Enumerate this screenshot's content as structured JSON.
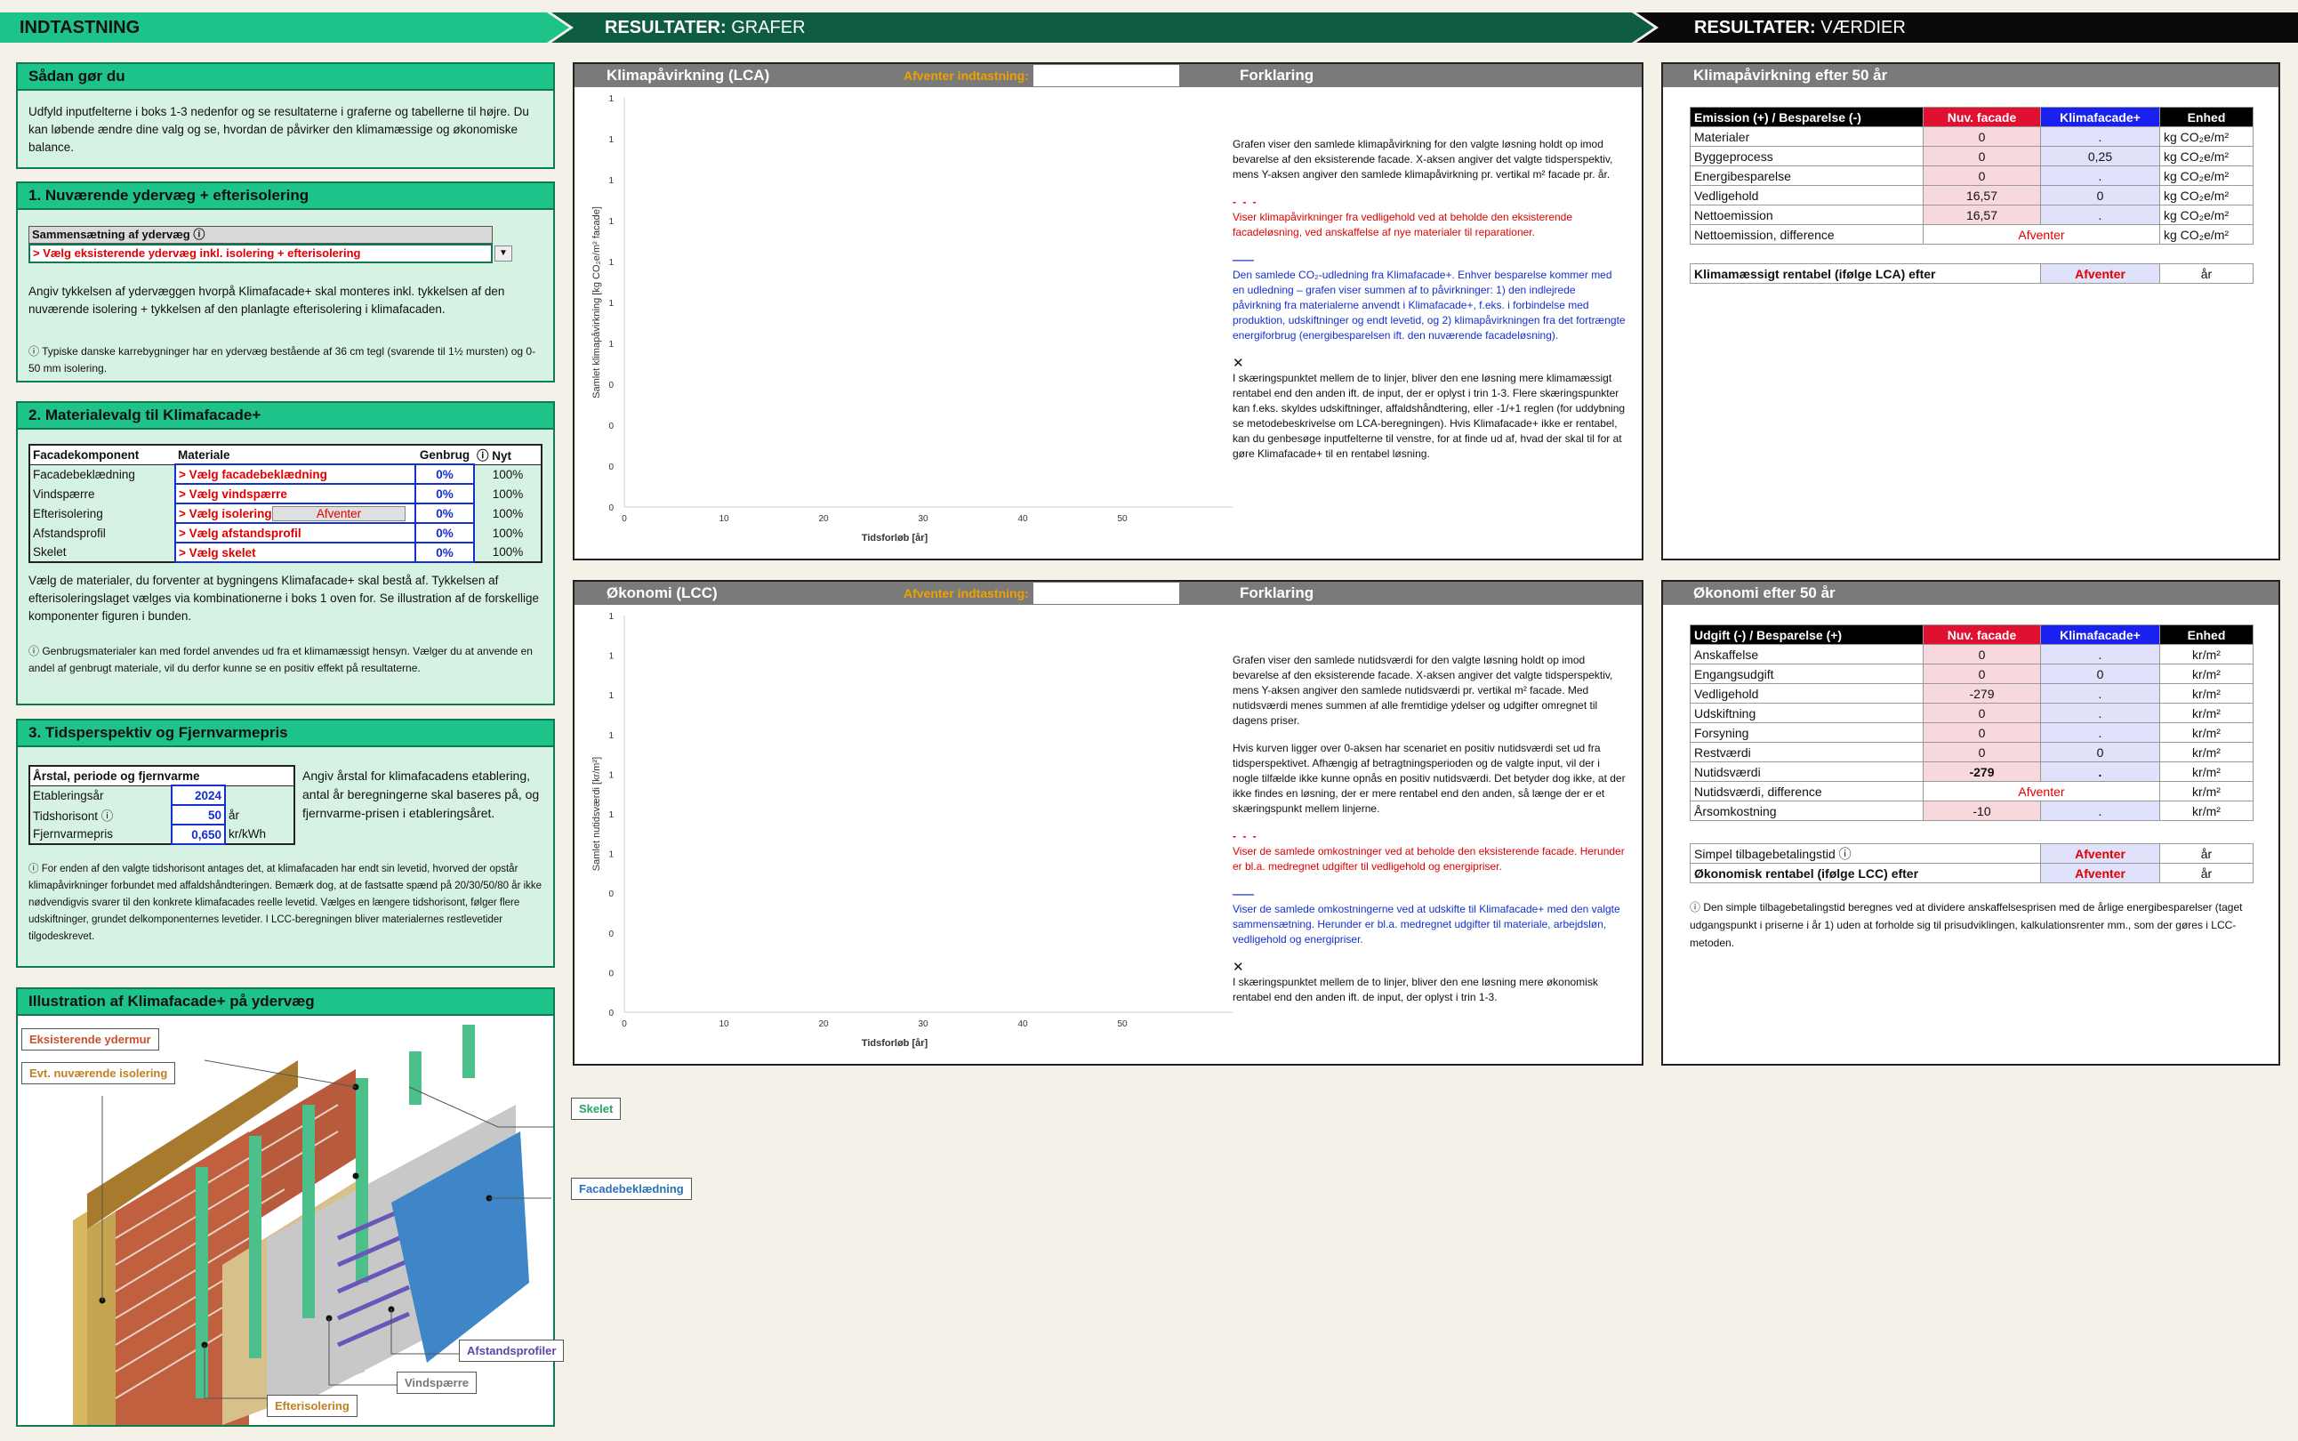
{
  "banners": {
    "input": "INDTASTNING",
    "graphs_bold": "RESULTATER:",
    "graphs_light": "GRAFER",
    "values_bold": "RESULTATER:",
    "values_light": "VÆRDIER"
  },
  "howto": {
    "title": "Sådan gør du",
    "text": "Udfyld inputfelterne i boks 1-3 nedenfor og se resultaterne i graferne og tabellerne til højre. Du kan løbende ændre dine valg og se, hvordan de påvirker den klimamæssige og økonomiske balance."
  },
  "section1": {
    "title": "1.  Nuværende ydervæg + efterisolering",
    "label": "Sammensætning af ydervæg ⓘ",
    "select_value": "> Vælg eksisterende ydervæg inkl. isolering + efterisolering",
    "text": "Angiv tykkelsen af ydervæggen hvorpå Klimafacade+ skal monteres inkl. tykkelsen af den nuværende isolering + tykkelsen af den planlagte efterisolering i klimafacaden.",
    "note": "ⓘ Typiske danske karrebygninger har en ydervæg bestående af 36 cm tegl (svarende til 1½ mursten) og 0-50 mm isolering."
  },
  "section2": {
    "title": "2. Materialevalg til Klimafacade+",
    "headers": [
      "Facadekomponent",
      "Materiale",
      "Genbrug",
      "ⓘ Nyt"
    ],
    "rows": [
      {
        "component": "Facadebeklædning",
        "material": "> Vælg facadebeklædning",
        "reuse": "0%",
        "new": "100%"
      },
      {
        "component": "Vindspærre",
        "material": "> Vælg vindspærre",
        "reuse": "0%",
        "new": "100%"
      },
      {
        "component": "Efterisolering",
        "material": "> Vælg isolering",
        "extra": "Afventer",
        "reuse": "0%",
        "new": "100%"
      },
      {
        "component": "Afstandsprofil",
        "material": "> Vælg afstandsprofil",
        "reuse": "0%",
        "new": "100%"
      },
      {
        "component": "Skelet",
        "material": "> Vælg skelet",
        "reuse": "0%",
        "new": "100%"
      }
    ],
    "text": "Vælg de materialer, du forventer at bygningens Klimafacade+ skal bestå af. Tykkelsen af efterisoleringslaget vælges via kombinationerne i boks 1 oven for. Se illustration af de forskellige komponenter figuren i bunden.",
    "note": "ⓘ Genbrugsmaterialer kan med fordel anvendes ud fra et klimamæssigt hensyn. Vælger du at anvende en andel af genbrugt materiale, vil du derfor kunne se en positiv effekt på resultaterne."
  },
  "section3": {
    "title": "3. Tidsperspektiv og Fjernvarmepris",
    "table_header": "Årstal, periode og fjernvarme",
    "rows": [
      {
        "label": "Etableringsår",
        "value": "2024",
        "unit": ""
      },
      {
        "label": "Tidshorisont ⓘ",
        "value": "50",
        "unit": "år"
      },
      {
        "label": "Fjernvarmepris",
        "value": "0,650",
        "unit": "kr/kWh"
      }
    ],
    "side_text": "Angiv årstal for klimafacadens etablering, antal år beregningerne skal baseres på, og fjernvarme-prisen i etableringsåret.",
    "note": "ⓘ For enden af den valgte tidshorisont antages det, at klimafacaden har endt sin levetid, hvorved der opstår klimapåvirkninger forbundet med affaldshåndteringen. Bemærk dog, at de fastsatte spænd på 20/30/50/80 år ikke nødvendigvis svarer til den konkrete klimafacades reelle levetid. Vælges en længere tidshorisont, følger flere udskiftninger, grundet delkomponenternes levetider. I LCC-beregningen bliver materialernes restlevetider tilgodeskrevet."
  },
  "illustration": {
    "title": "Illustration af Klimafacade+ på ydervæg",
    "labels": {
      "existing_wall": "Eksisterende ydermur",
      "existing_insulation": "Evt. nuværende isolering",
      "frame": "Skelet",
      "cladding": "Facadebeklædning",
      "spacers": "Afstandsprofiler",
      "windbarrier": "Vindspærre",
      "insulation": "Efterisolering"
    }
  },
  "lca_chart": {
    "title": "Klimapåvirkning (LCA)",
    "waiting_label": "Afventer indtastning:",
    "legend_title": "Forklaring",
    "ylabel": "Samlet klimapåvirkning   [kg CO₂e/m² facade]",
    "xlabel": "Tidsforløb   [år]",
    "y_ticks": [
      "1",
      "1",
      "1",
      "1",
      "1",
      "1",
      "1",
      "0",
      "0",
      "0",
      "0"
    ],
    "x_ticks": [
      "0",
      "10",
      "20",
      "30",
      "40",
      "50"
    ],
    "expl_1": "Grafen viser den samlede klimapåvirkning for den valgte løsning holdt op imod bevarelse af den eksisterende facade. X-aksen angiver det valgte tidsperspektiv, mens Y-aksen angiver den samlede klimapåvirkning pr. vertikal m² facade pr. år.",
    "expl_red": "Viser klimapåvirkninger fra vedligehold ved at beholde den eksisterende facadeløsning, ved anskaffelse af nye materialer til reparationer.",
    "expl_blue": "Den samlede CO₂-udledning fra Klimafacade+. Enhver besparelse kommer med en udledning – grafen viser summen af to påvirkninger: 1) den indlejrede påvirkning fra materialerne anvendt i Klimafacade+, f.eks. i forbindelse med produktion, udskiftninger og endt levetid, og 2) klimapåvirkningen fra det fortrængte energiforbrug (energibesparelsen ift. den nuværende facadeløsning).",
    "expl_cross": "I skæringspunktet mellem de to linjer, bliver den ene løsning mere klimamæssigt rentabel end den anden ift. de input, der er oplyst i trin 1-3. Flere skæringspunkter kan f.eks. skyldes udskiftninger, affaldshåndtering, eller -1/+1 reglen (for uddybning se metodebeskrivelse om LCA-beregningen). Hvis Klimafacade+ ikke er rentabel, kan du genbesøge inputfelterne til venstre, for at finde ud af, hvad der skal til for at gøre Klimafacade+ til en rentabel løsning."
  },
  "lcc_chart": {
    "title": "Økonomi (LCC)",
    "waiting_label": "Afventer indtastning:",
    "legend_title": "Forklaring",
    "ylabel": "Samlet nutidsværdi   [kr/m²]",
    "xlabel": "Tidsforløb   [år]",
    "y_ticks": [
      "1",
      "1",
      "1",
      "1",
      "1",
      "1",
      "1",
      "0",
      "0",
      "0",
      "0"
    ],
    "x_ticks": [
      "0",
      "10",
      "20",
      "30",
      "40",
      "50"
    ],
    "expl_1": "Grafen viser den samlede nutidsværdi for den valgte løsning holdt op imod bevarelse af den eksisterende facade. X-aksen angiver det valgte tidsperspektiv, mens Y-aksen angiver den samlede nutidsværdi pr. vertikal m² facade. Med nutidsværdi menes summen af alle fremtidige ydelser og udgifter omregnet til dagens priser.",
    "expl_2": "Hvis kurven ligger over 0-aksen har scenariet en positiv nutidsværdi set ud fra tidsperspektivet. Afhængig af betragtningsperioden og de valgte input, vil der i nogle tilfælde ikke kunne opnås en positiv nutidsværdi. Det betyder dog ikke, at der ikke findes en løsning, der er mere rentabel end den anden, så længe der er et skæringspunkt mellem linjerne.",
    "expl_red": "Viser de samlede omkostninger ved at beholde den eksisterende facade. Herunder er bl.a. medregnet udgifter til vedligehold og energipriser.",
    "expl_blue": "Viser de samlede omkostningerne ved at udskifte til Klimafacade+ med den valgte sammensætning. Herunder er bl.a. medregnet udgifter til materiale, arbejdsløn, vedligehold og energipriser.",
    "expl_cross": "I skæringspunktet mellem de to linjer, bliver den ene løsning mere økonomisk rentabel end den anden ift. de input, der oplyst i trin 1-3."
  },
  "lca_values": {
    "title": "Klimapåvirkning efter 50 år",
    "headers": [
      "Emission (+) / Besparelse (-)",
      "Nuv. facade",
      "Klimafacade+",
      "Enhed"
    ],
    "rows": [
      {
        "label": "Materialer",
        "a": "0",
        "b": ".",
        "unit": "kg CO₂e/m²"
      },
      {
        "label": "Byggeprocess",
        "a": "0",
        "b": "0,25",
        "unit": "kg CO₂e/m²"
      },
      {
        "label": "Energibesparelse",
        "a": "0",
        "b": ".",
        "unit": "kg CO₂e/m²"
      },
      {
        "label": "Vedligehold",
        "a": "16,57",
        "b": "0",
        "unit": "kg CO₂e/m²"
      },
      {
        "label": "Nettoemission",
        "a": "16,57",
        "b": ".",
        "unit": "kg CO₂e/m²"
      }
    ],
    "diff_label": "Nettoemission, difference",
    "diff_value": "Afventer",
    "diff_unit": "kg CO₂e/m²",
    "rent_label": "Klimamæssigt rentabel (ifølge LCA) efter",
    "rent_value": "Afventer",
    "rent_unit": "år"
  },
  "lcc_values": {
    "title": "Økonomi efter 50 år",
    "headers": [
      "Udgift (-) / Besparelse (+)",
      "Nuv. facade",
      "Klimafacade+",
      "Enhed"
    ],
    "rows": [
      {
        "label": "Anskaffelse",
        "a": "0",
        "b": ".",
        "unit": "kr/m²"
      },
      {
        "label": "Engangsudgift",
        "a": "0",
        "b": "0",
        "unit": "kr/m²"
      },
      {
        "label": "Vedligehold",
        "a": "-279",
        "b": ".",
        "unit": "kr/m²"
      },
      {
        "label": "Udskiftning",
        "a": "0",
        "b": ".",
        "unit": "kr/m²"
      },
      {
        "label": "Forsyning",
        "a": "0",
        "b": ".",
        "unit": "kr/m²"
      },
      {
        "label": "Restværdi",
        "a": "0",
        "b": "0",
        "unit": "kr/m²"
      },
      {
        "label": "Nutidsværdi",
        "a": "-279",
        "b": ".",
        "unit": "kr/m²"
      }
    ],
    "diff_label": "Nutidsværdi, difference",
    "diff_value": "Afventer",
    "diff_unit": "kr/m²",
    "annual_label": "Årsomkostning",
    "annual_a": "-10",
    "annual_b": ".",
    "annual_unit": "kr/m²",
    "payback_label": "Simpel tilbagebetalingstid ⓘ",
    "payback_value": "Afventer",
    "payback_unit": "år",
    "rent_label": "Økonomisk rentabel (ifølge LCC) efter",
    "rent_value": "Afventer",
    "rent_unit": "år",
    "note": "ⓘ Den simple tilbagebetalingstid beregnes ved at dividere anskaffelsesprisen med de årlige energibesparelser (taget udgangspunkt i priserne i år 1) uden at forholde sig til prisudviklingen, kalkulationsrenter mm., som der gøres i LCC-metoden."
  },
  "colors": {
    "green_header": "#1ec38a",
    "dark_green": "#0e5c42",
    "red": "#e01030",
    "blue": "#1a20f0",
    "orange": "#f0a000"
  }
}
